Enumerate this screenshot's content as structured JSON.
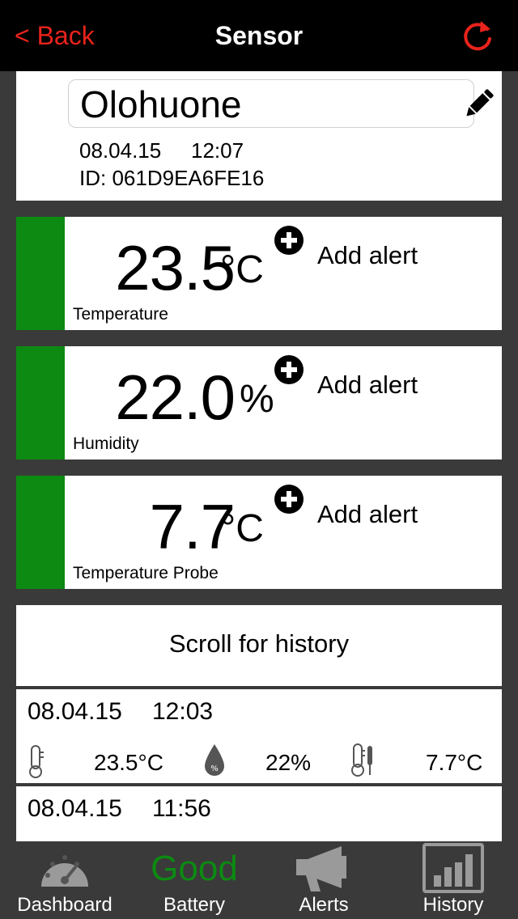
{
  "nav": {
    "back_label": "< Back",
    "title": "Sensor",
    "refresh_icon": "refresh-icon"
  },
  "sensor": {
    "name": "Olohuone",
    "date": "08.04.15",
    "time": "12:07",
    "id_label": "ID: 061D9EA6FE16"
  },
  "readings": [
    {
      "value": "23.5",
      "unit": "°C",
      "label": "Temperature",
      "alert_label": "Add alert",
      "status_color": "#0d8a12"
    },
    {
      "value": "22.0",
      "unit": "%",
      "label": "Humidity",
      "alert_label": "Add alert",
      "status_color": "#0d8a12"
    },
    {
      "value": "7.7",
      "unit": "°C",
      "label": "Temperature Probe",
      "alert_label": "Add alert",
      "status_color": "#0d8a12"
    }
  ],
  "history": {
    "scroll_label": "Scroll for history",
    "entries": [
      {
        "date": "08.04.15",
        "time": "12:03",
        "temperature": "23.5°C",
        "humidity": "22%",
        "probe": "7.7°C"
      },
      {
        "date": "08.04.15",
        "time": "11:56"
      }
    ]
  },
  "tabbar": {
    "items": [
      {
        "label": "Dashboard",
        "icon": "gauge-icon"
      },
      {
        "label": "Battery",
        "status": "Good",
        "status_color": "#0d8a12"
      },
      {
        "label": "Alerts",
        "icon": "megaphone-icon"
      },
      {
        "label": "History",
        "icon": "bar-chart-icon"
      }
    ]
  },
  "colors": {
    "accent": "#e8231c",
    "status_good": "#0d8a12",
    "background": "#3a3a3a"
  }
}
